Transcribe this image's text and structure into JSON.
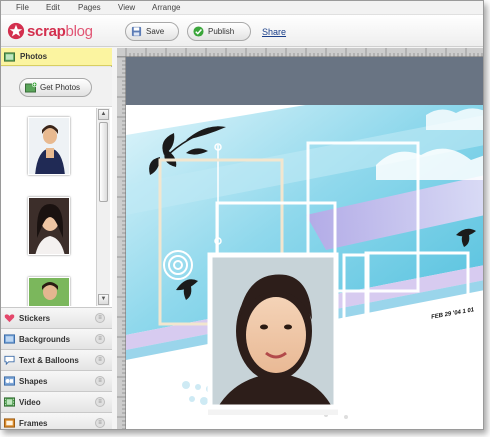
{
  "menu": [
    "File",
    "Edit",
    "Pages",
    "View",
    "Arrange"
  ],
  "app": {
    "logo_text_a": "scrap",
    "logo_text_b": "blog",
    "brand_color": "#d32f4e"
  },
  "toolbar": {
    "save_label": "Save",
    "publish_label": "Publish",
    "share_label": "Share"
  },
  "sidebar": {
    "photos_header": "Photos",
    "get_photos_label": "Get Photos",
    "sections": [
      "Stickers",
      "Backgrounds",
      "Text & Balloons",
      "Shapes",
      "Video",
      "Frames"
    ]
  },
  "canvas": {
    "date_stamp": "FEB 29 '04 1 01"
  },
  "colors": {
    "header_highlight": "#fbf4a0",
    "page_band": "#697483",
    "sky_blue": "#63c7e0"
  }
}
